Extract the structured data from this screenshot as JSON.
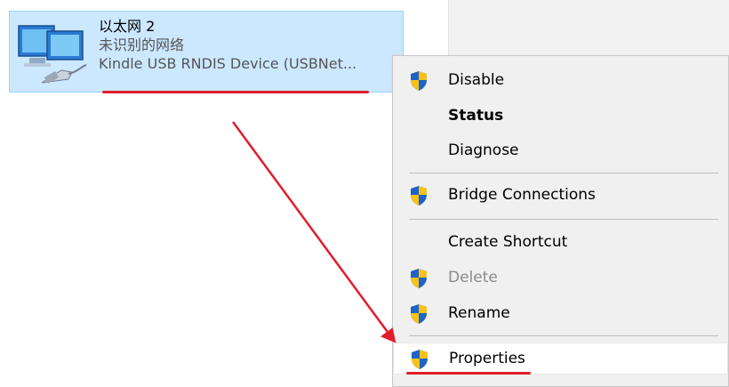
{
  "adapter": {
    "name": "以太网 2",
    "status": "未识别的网络",
    "device": "Kindle USB RNDIS Device (USBNet..."
  },
  "context_menu": {
    "items": [
      {
        "label": "Disable",
        "icon": "shield-icon"
      },
      {
        "label": "Status"
      },
      {
        "label": "Diagnose"
      },
      {
        "label": "Bridge Connections",
        "icon": "shield-icon"
      },
      {
        "label": "Create Shortcut"
      },
      {
        "label": "Delete",
        "icon": "shield-icon",
        "disabled": true
      },
      {
        "label": "Rename",
        "icon": "shield-icon"
      },
      {
        "label": "Properties",
        "icon": "shield-icon",
        "highlighted": true
      }
    ]
  },
  "colors": {
    "selection_bg": "#cce8ff",
    "annotation_red": "#e01e2b",
    "shield_blue": "#1f63c6",
    "shield_yellow": "#f6c21a"
  }
}
